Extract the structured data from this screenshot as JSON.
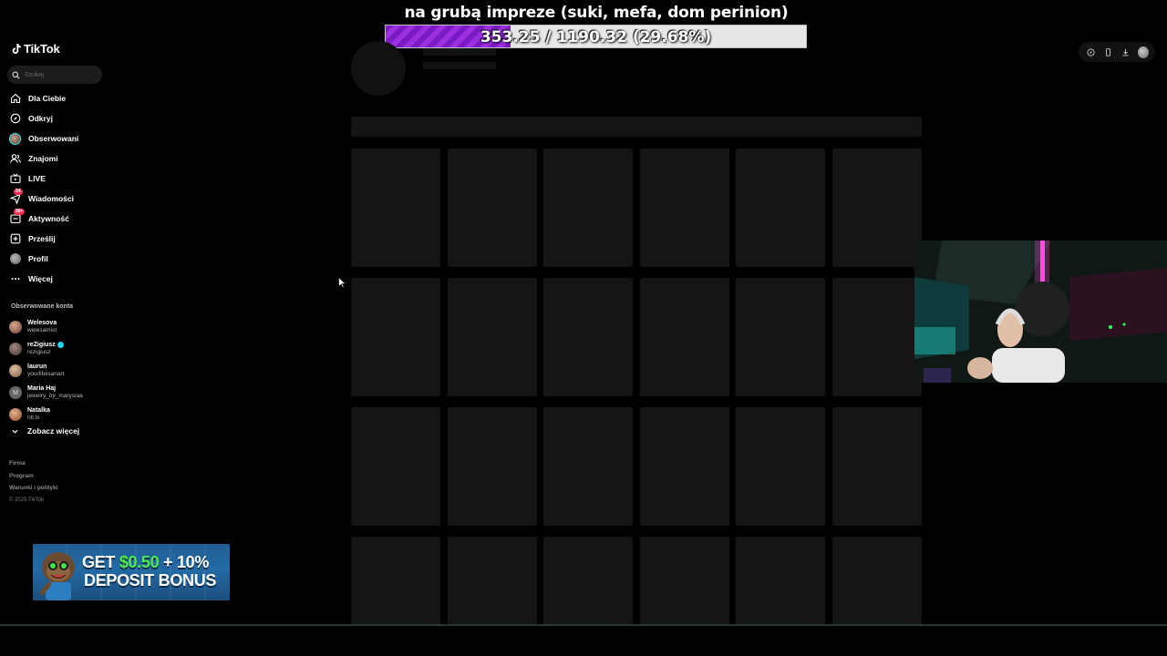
{
  "stream_goal": {
    "title": "na grubą impreze (suki, mefa, dom perinion)",
    "progress_text": "353.25 / 1190.32 (29.68%)",
    "current": 353.25,
    "target": 1190.32,
    "percent": 29.68,
    "fill_color": "#8a24d4"
  },
  "sidebar": {
    "logo": "TikTok",
    "search_placeholder": "Szukaj",
    "nav": [
      {
        "label": "Dla Ciebie",
        "icon": "home-icon"
      },
      {
        "label": "Odkryj",
        "icon": "compass-icon"
      },
      {
        "label": "Obserwowani",
        "icon": "avatar-icon"
      },
      {
        "label": "Znajomi",
        "icon": "friends-icon"
      },
      {
        "label": "LIVE",
        "icon": "live-icon"
      },
      {
        "label": "Wiadomości",
        "icon": "messages-icon",
        "badge": "54"
      },
      {
        "label": "Aktywność",
        "icon": "activity-icon",
        "badge": "99+"
      },
      {
        "label": "Prześlij",
        "icon": "upload-icon"
      },
      {
        "label": "Profil",
        "icon": "profile-icon"
      },
      {
        "label": "Więcej",
        "icon": "more-icon"
      }
    ],
    "followed_title": "Obserwowane konta",
    "accounts": [
      {
        "name": "Welesova",
        "username": "welesamist"
      },
      {
        "name": "reZigiusz",
        "username": "rezigiusz",
        "verified": true
      },
      {
        "name": "laurun",
        "username": "yourlifeisanart"
      },
      {
        "name": "Maria Haj",
        "username": "jewelry_by_marysiaa",
        "initial": "M"
      },
      {
        "name": "Natalka",
        "username": "ntl.lx"
      }
    ],
    "see_more": "Zobacz więcej",
    "footer": {
      "links": [
        "Firma",
        "Program",
        "Warunki i polityki"
      ],
      "copyright": "© 2025 TikTok"
    }
  },
  "ad_banner": {
    "line1_prefix": "GET ",
    "line1_highlight": "$0.50",
    "line1_suffix": " + 10%",
    "line2": "DEPOSIT BONUS"
  },
  "top_right_icons": [
    "compass-icon",
    "phone-icon",
    "download-icon",
    "avatar-icon"
  ],
  "colors": {
    "background": "#000000",
    "accent": "#fe2c55",
    "cyan": "#25f4ee",
    "skeleton": "#151515"
  }
}
